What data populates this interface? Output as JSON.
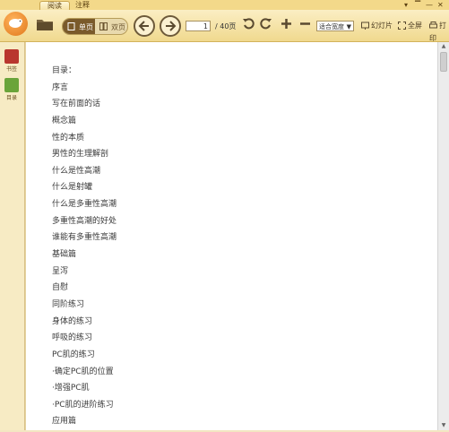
{
  "tabs": [
    {
      "label": "阅读",
      "active": true
    },
    {
      "label": "注释",
      "active": false
    }
  ],
  "window_controls": [
    "▾",
    "▔",
    "—",
    "✕"
  ],
  "toolbar": {
    "view_single_label": "单页",
    "view_double_label": "双页",
    "current_page": "1",
    "total_pages": "/ 40页",
    "fit_option": "适合宽度",
    "slideshow_label": "幻灯片",
    "fullscreen_label": "全屏",
    "print_label": "打印"
  },
  "sidebar": {
    "items": [
      {
        "label": "书签",
        "icon": "bookmark-icon",
        "color": "#b9362e"
      },
      {
        "label": "目录",
        "icon": "toc-icon",
        "color": "#6aa43a"
      }
    ]
  },
  "toc": {
    "items": [
      "目录：",
      "序言",
      "写在前面的话",
      "概念篇",
      "性的本质",
      "男性的生理解剖",
      "什么是性高潮",
      "什么是射罐",
      "什么是多重性高潮",
      "多重性高潮的好处",
      "谁能有多重性高潮",
      "基础篇",
      "呈泻",
      "自慰",
      "同阶练习",
      "身体的练习",
      "呼吸的练习",
      "PC肌的练习",
      "·确定PC肌的位置",
      "·增强PC肌",
      "·PC肌的进阶练习",
      "应用篇"
    ]
  },
  "colors": {
    "toolbar_bg": "#f0d98e",
    "accent": "#7a5a2b",
    "page_bg": "#ffffff"
  }
}
